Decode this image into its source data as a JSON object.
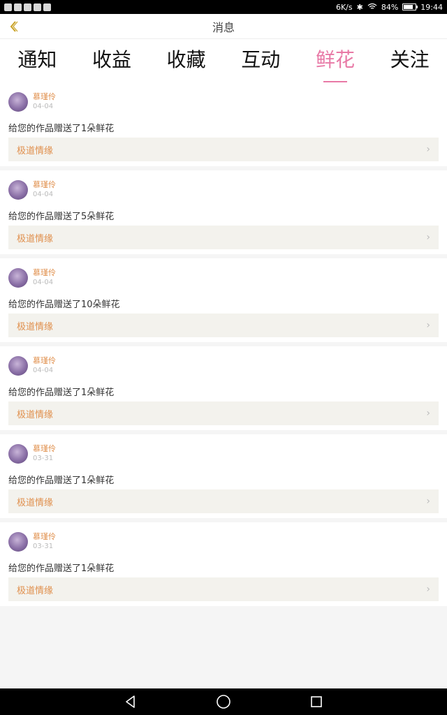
{
  "status_bar": {
    "speed": "6K/s",
    "battery": "84%",
    "battery_level": 0.84,
    "time": "19:44"
  },
  "header": {
    "title": "消息"
  },
  "tabs": [
    {
      "label": "通知",
      "active": false
    },
    {
      "label": "收益",
      "active": false
    },
    {
      "label": "收藏",
      "active": false
    },
    {
      "label": "互动",
      "active": false
    },
    {
      "label": "鲜花",
      "active": true
    },
    {
      "label": "关注",
      "active": false
    }
  ],
  "messages": [
    {
      "username": "慕瑾伶",
      "date": "04-04",
      "text": "给您的作品赠送了1朵鲜花",
      "work": "极道情缘"
    },
    {
      "username": "慕瑾伶",
      "date": "04-04",
      "text": "给您的作品赠送了5朵鲜花",
      "work": "极道情缘"
    },
    {
      "username": "慕瑾伶",
      "date": "04-04",
      "text": "给您的作品赠送了10朵鲜花",
      "work": "极道情缘"
    },
    {
      "username": "慕瑾伶",
      "date": "04-04",
      "text": "给您的作品赠送了1朵鲜花",
      "work": "极道情缘"
    },
    {
      "username": "慕瑾伶",
      "date": "03-31",
      "text": "给您的作品赠送了1朵鲜花",
      "work": "极道情缘"
    },
    {
      "username": "慕瑾伶",
      "date": "03-31",
      "text": "给您的作品赠送了1朵鲜花",
      "work": "极道情缘"
    }
  ],
  "colors": {
    "accent_pink": "#e879a6",
    "username_orange": "#e0904e",
    "back_arrow": "#c9a227"
  },
  "icons": {
    "back": "chevron-left-icon",
    "nav_back": "triangle-back-icon",
    "nav_home": "circle-home-icon",
    "nav_recent": "square-recent-icon"
  }
}
